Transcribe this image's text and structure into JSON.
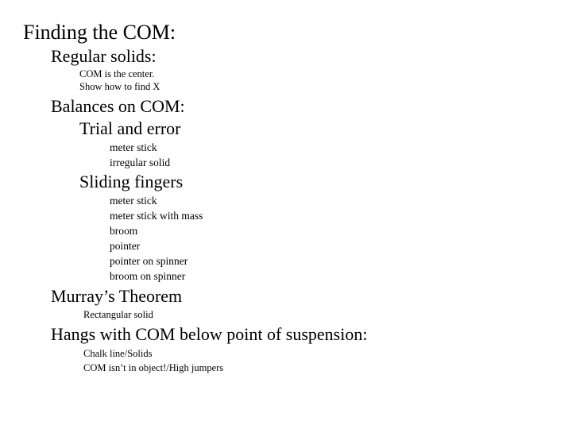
{
  "slide": {
    "title": "Finding the COM:",
    "background_color": "#ffffff",
    "text_color": "#000000",
    "blocks": [
      {
        "heading": "Regular solids:",
        "notes": [
          "COM is the center.",
          "Show how to find X"
        ]
      },
      {
        "heading": "Balances on COM:",
        "subheading": "Trial and error",
        "items": [
          "meter stick",
          "irregular solid"
        ]
      },
      {
        "subheading": "Sliding fingers",
        "items": [
          "meter stick",
          "meter stick with mass",
          "broom",
          "pointer",
          "pointer on spinner",
          "broom on spinner"
        ]
      },
      {
        "heading": "Murray’s Theorem",
        "notes": [
          "Rectangular solid"
        ]
      },
      {
        "heading": "Hangs with COM below point of suspension:",
        "notes": [
          "Chalk line/Solids",
          "COM isn’t in object!/High jumpers"
        ]
      }
    ]
  },
  "text": {
    "title": "Finding the COM:",
    "regular_solids": "Regular solids:",
    "com_is_the_center": "COM is the center.",
    "show_how_to_find_x": "Show how to find X",
    "balances_on_com": "Balances on COM:",
    "trial_and_error": "Trial and error",
    "trial_item_1": "meter stick",
    "trial_item_2": "irregular solid",
    "sliding_fingers": "Sliding fingers",
    "sliding_item_1": "meter stick",
    "sliding_item_2": "meter stick with mass",
    "sliding_item_3": "broom",
    "sliding_item_4": "pointer",
    "sliding_item_5": "pointer on spinner",
    "sliding_item_6": "broom on spinner",
    "murrays_theorem": "Murray’s Theorem",
    "rectangular_solid": "Rectangular solid",
    "hangs_with_com": "Hangs with COM below point of suspension:",
    "chalk_line_solids": "Chalk line/Solids",
    "com_isnt_in_object": "COM isn’t in object!/High jumpers"
  }
}
